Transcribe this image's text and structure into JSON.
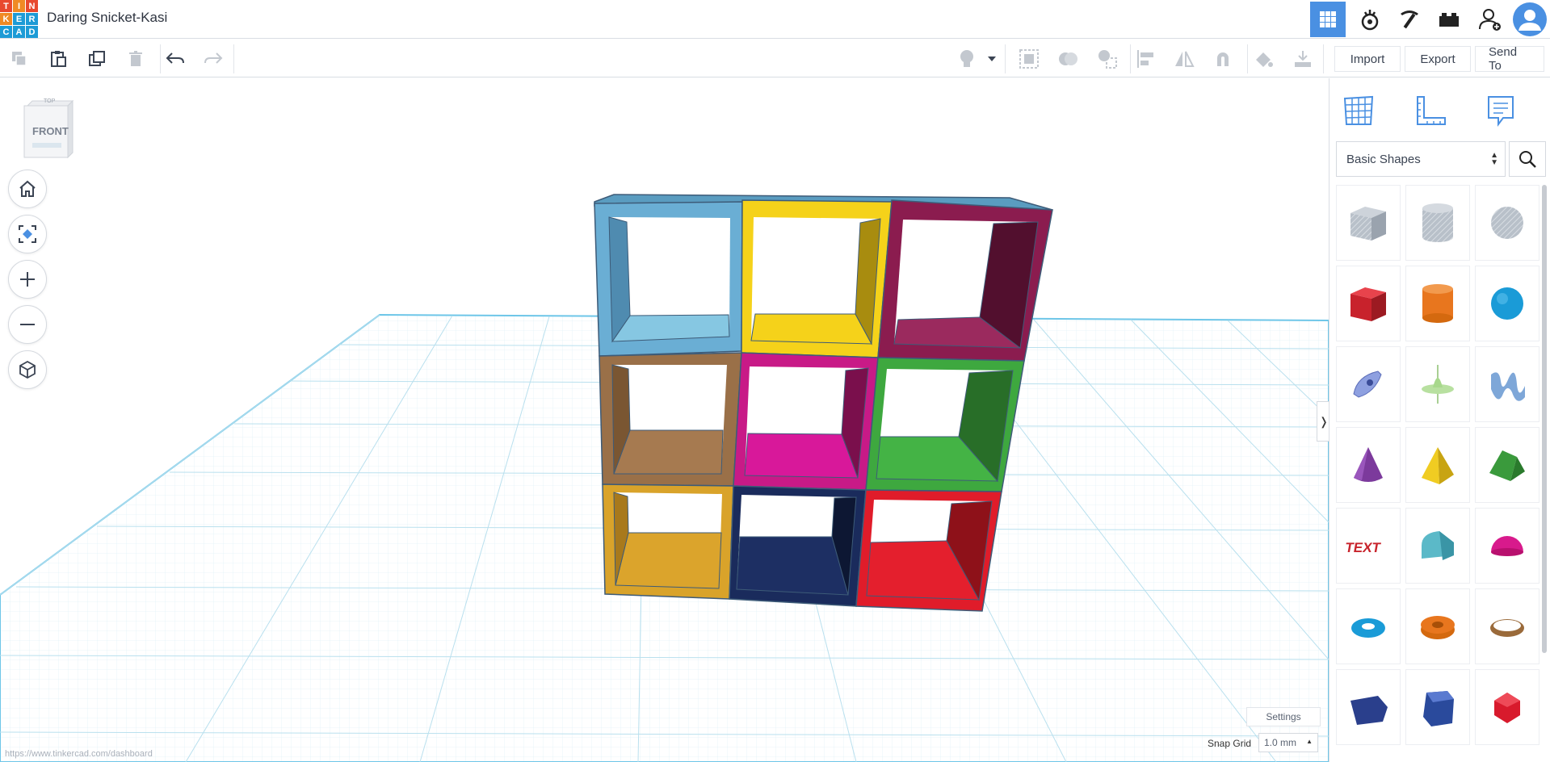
{
  "app": {
    "logo_letters": [
      "T",
      "I",
      "N",
      "K",
      "E",
      "R",
      "C",
      "A",
      "D"
    ],
    "document_title": "Daring Snicket-Kasi"
  },
  "top_nav": {
    "icons": [
      "grid-view-icon",
      "sim-lab-icon",
      "minecraft-pickaxe-icon",
      "lego-brick-icon",
      "add-user-icon",
      "profile-avatar-icon"
    ],
    "active": "grid-view-icon",
    "active_color": "#4a90e2"
  },
  "toolbar": {
    "import_label": "Import",
    "export_label": "Export",
    "send_to_label": "Send To"
  },
  "view_cube": {
    "front_label": "FRONT",
    "top_label": "TOP"
  },
  "workplane": {
    "settings_label": "Settings",
    "snap_grid_label": "Snap Grid",
    "snap_grid_value": "1.0 mm",
    "status_url": "https://www.tinkercad.com/dashboard",
    "grid_color": "#bfe3f0",
    "edge_color": "#6ec6e8"
  },
  "model": {
    "cells": [
      {
        "row": 1,
        "col": 1,
        "color": "#6aaed4"
      },
      {
        "row": 1,
        "col": 2,
        "color": "#f5d21a"
      },
      {
        "row": 1,
        "col": 3,
        "color": "#8b1c4f"
      },
      {
        "row": 2,
        "col": 1,
        "color": "#9a7048"
      },
      {
        "row": 2,
        "col": 2,
        "color": "#c81a87"
      },
      {
        "row": 2,
        "col": 3,
        "color": "#3ea83f"
      },
      {
        "row": 3,
        "col": 1,
        "color": "#d9a32a"
      },
      {
        "row": 3,
        "col": 2,
        "color": "#1a2b5c"
      },
      {
        "row": 3,
        "col": 3,
        "color": "#e01c2a"
      }
    ]
  },
  "side_panel": {
    "tabs": [
      "workplane-grid-icon",
      "ruler-icon",
      "notes-icon"
    ],
    "shape_category": "Basic Shapes",
    "shapes": [
      {
        "name": "box-hole",
        "color": "#aab2bc"
      },
      {
        "name": "cylinder-hole",
        "color": "#b4bcc6"
      },
      {
        "name": "sphere-hole",
        "color": "#b0b7c1"
      },
      {
        "name": "box",
        "color": "#d22630"
      },
      {
        "name": "cylinder",
        "color": "#e8761e"
      },
      {
        "name": "sphere",
        "color": "#1a9bd7"
      },
      {
        "name": "scribble",
        "color": "#7a8fd8"
      },
      {
        "name": "shape-generator",
        "color": "#a8d88c"
      },
      {
        "name": "text-wave",
        "color": "#7ea7d8"
      },
      {
        "name": "cone",
        "color": "#7c3a9c"
      },
      {
        "name": "pyramid",
        "color": "#e8c21a"
      },
      {
        "name": "roof",
        "color": "#3a9a3c"
      },
      {
        "name": "text",
        "color": "#c8242c"
      },
      {
        "name": "round-roof",
        "color": "#5bb9c8"
      },
      {
        "name": "half-sphere",
        "color": "#d81a8c"
      },
      {
        "name": "torus",
        "color": "#1a9bd7"
      },
      {
        "name": "tube",
        "color": "#e8761e"
      },
      {
        "name": "ring",
        "color": "#9a6a3a"
      },
      {
        "name": "polygon",
        "color": "#2a3f8c"
      },
      {
        "name": "prism",
        "color": "#2a4a9c"
      },
      {
        "name": "icosahedron",
        "color": "#d81a2c"
      }
    ]
  }
}
